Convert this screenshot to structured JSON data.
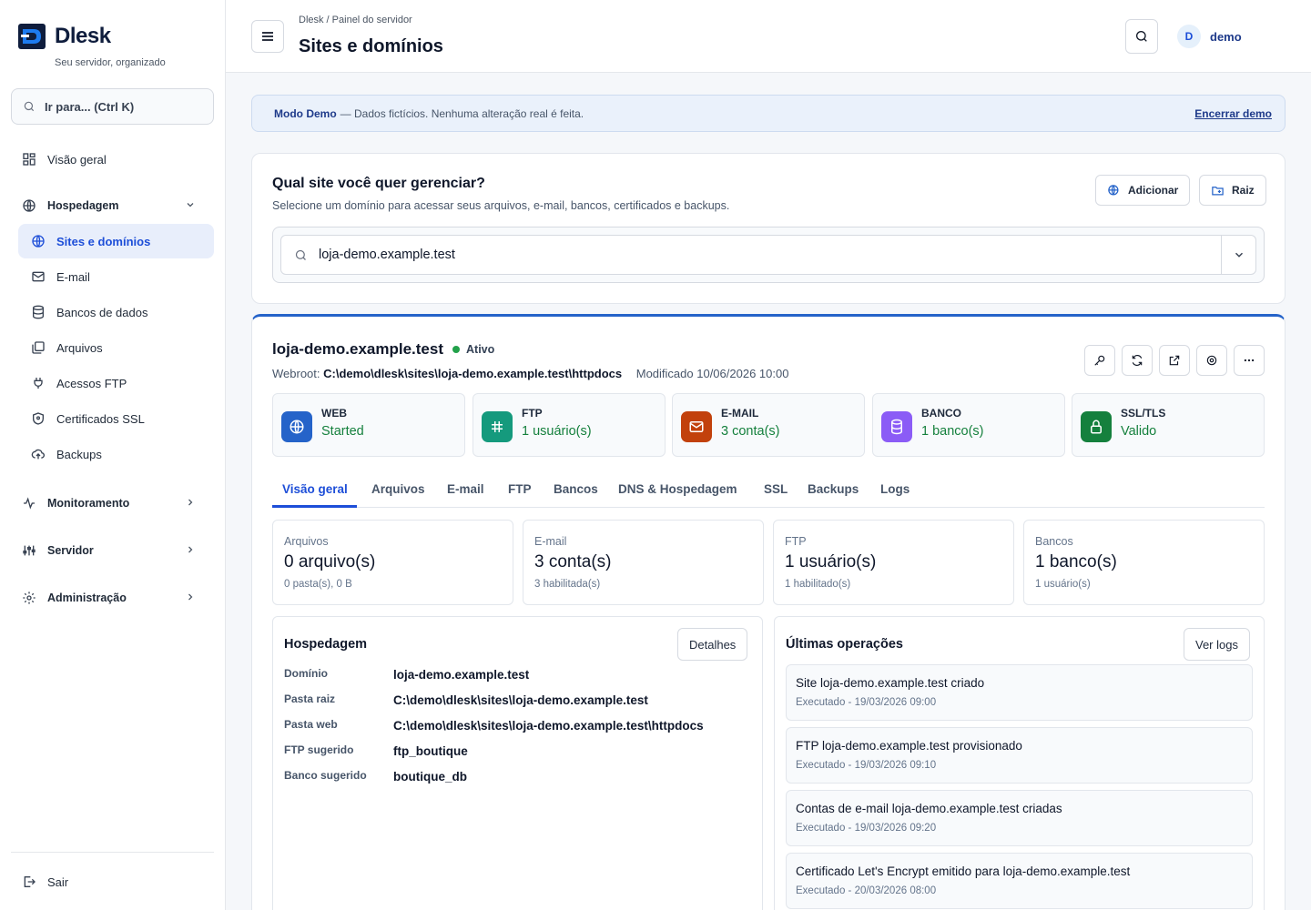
{
  "brand": {
    "name": "Dlesk",
    "tagline": "Seu servidor, organizado"
  },
  "goto": {
    "label": "Ir para... (Ctrl K)"
  },
  "nav": {
    "overview": "Visão geral",
    "hosting": "Hospedagem",
    "hosting_items": [
      "Sites e domínios",
      "E-mail",
      "Bancos de dados",
      "Arquivos",
      "Acessos FTP",
      "Certificados SSL",
      "Backups"
    ],
    "monitoring": "Monitoramento",
    "server": "Servidor",
    "admin": "Administração",
    "logout": "Sair"
  },
  "header": {
    "breadcrumb": "Dlesk / Painel do servidor",
    "title": "Sites e domínios",
    "avatar": "D",
    "user": "demo"
  },
  "banner": {
    "strong": "Modo Demo",
    "text": "— Dados fictícios. Nenhuma alteração real é feita.",
    "link": "Encerrar demo"
  },
  "selector": {
    "title": "Qual site você quer gerenciar?",
    "subtitle": "Selecione um domínio para acessar seus arquivos, e-mail, bancos, certificados e backups.",
    "add_label": "Adicionar",
    "root_label": "Raiz",
    "domain": "loja-demo.example.test"
  },
  "site": {
    "name": "loja-demo.example.test",
    "status": "Ativo",
    "webroot_label": "Webroot:",
    "webroot": "C:\\demo\\dlesk\\sites\\loja-demo.example.test\\httpdocs",
    "modified": "Modificado 10/06/2026 10:00"
  },
  "services": [
    {
      "label": "WEB",
      "value": "Started",
      "color": "#2563c9"
    },
    {
      "label": "FTP",
      "value": "1 usuário(s)",
      "color": "#159a7d"
    },
    {
      "label": "E-MAIL",
      "value": "3 conta(s)",
      "color": "#c2410c"
    },
    {
      "label": "BANCO",
      "value": "1 banco(s)",
      "color": "#8b5cf6"
    },
    {
      "label": "SSL/TLS",
      "value": "Valido",
      "color": "#15803d"
    }
  ],
  "tabs": [
    "Visão geral",
    "Arquivos",
    "E-mail",
    "FTP",
    "Bancos",
    "DNS & Hospedagem",
    "SSL",
    "Backups",
    "Logs"
  ],
  "stats": [
    {
      "title": "Arquivos",
      "value": "0 arquivo(s)",
      "sub": "0 pasta(s), 0 B"
    },
    {
      "title": "E-mail",
      "value": "3 conta(s)",
      "sub": "3 habilitada(s)"
    },
    {
      "title": "FTP",
      "value": "1 usuário(s)",
      "sub": "1 habilitado(s)"
    },
    {
      "title": "Bancos",
      "value": "1 banco(s)",
      "sub": "1 usuário(s)"
    }
  ],
  "hosting": {
    "title": "Hospedagem",
    "button": "Detalhes",
    "rows": [
      {
        "k": "Domínio",
        "v": "loja-demo.example.test"
      },
      {
        "k": "Pasta raiz",
        "v": "C:\\demo\\dlesk\\sites\\loja-demo.example.test"
      },
      {
        "k": "Pasta web",
        "v": "C:\\demo\\dlesk\\sites\\loja-demo.example.test\\httpdocs"
      },
      {
        "k": "FTP sugerido",
        "v": "ftp_boutique"
      },
      {
        "k": "Banco sugerido",
        "v": "boutique_db"
      }
    ]
  },
  "operations": {
    "title": "Últimas operações",
    "button": "Ver logs",
    "items": [
      {
        "title": "Site loja-demo.example.test criado",
        "sub": "Executado - 19/03/2026 09:00"
      },
      {
        "title": "FTP loja-demo.example.test provisionado",
        "sub": "Executado - 19/03/2026 09:10"
      },
      {
        "title": "Contas de e-mail loja-demo.example.test criadas",
        "sub": "Executado - 19/03/2026 09:20"
      },
      {
        "title": "Certificado Let's Encrypt emitido para loja-demo.example.test",
        "sub": "Executado - 20/03/2026 08:00"
      }
    ]
  }
}
